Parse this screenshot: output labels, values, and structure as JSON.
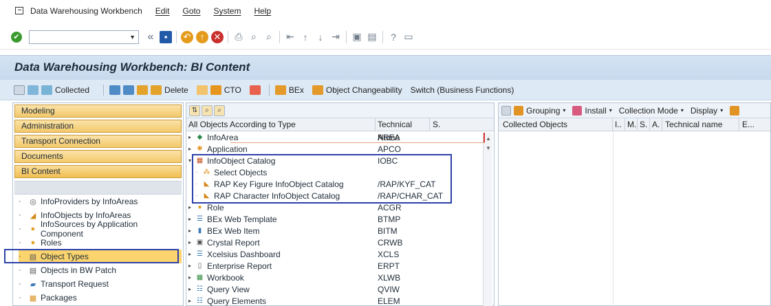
{
  "menu": {
    "items": [
      "Data Warehousing Workbench",
      "Edit",
      "Goto",
      "System",
      "Help"
    ]
  },
  "toolbar": {
    "command_field_value": ""
  },
  "title": "Data Warehousing Workbench: BI Content",
  "app_toolbar": {
    "collected": "Collected",
    "delete": "Delete",
    "cto": "CTO",
    "bex": "BEx",
    "object_changeability": "Object Changeability",
    "switch": "Switch (Business Functions)"
  },
  "nav_buttons": [
    "Modeling",
    "Administration",
    "Transport Connection",
    "Documents",
    "BI Content"
  ],
  "left_tree": [
    {
      "label": "InfoProviders by InfoAreas",
      "icon": "infoprovider-icon"
    },
    {
      "label": "InfoObjects by InfoAreas",
      "icon": "infoobject-icon"
    },
    {
      "label": "InfoSources by Application Component",
      "icon": "infosource-icon"
    },
    {
      "label": "Roles",
      "icon": "role-icon"
    },
    {
      "label": "Object Types",
      "icon": "document-icon"
    },
    {
      "label": "Objects in BW Patch",
      "icon": "document-icon"
    },
    {
      "label": "Transport Request",
      "icon": "transport-icon"
    },
    {
      "label": "Packages",
      "icon": "package-icon"
    }
  ],
  "mid_columns": {
    "c1": "All Objects According to Type",
    "c2": "Technical Name",
    "c3": "S."
  },
  "mid_rows": [
    {
      "name": "InfoArea",
      "tech": "AREA",
      "level": 0,
      "expanded": false
    },
    {
      "name": "Application",
      "tech": "APCO",
      "level": 0,
      "expanded": false
    },
    {
      "name": "InfoObject Catalog",
      "tech": "IOBC",
      "level": 0,
      "expanded": true
    },
    {
      "name": "Select Objects",
      "tech": "",
      "level": 1,
      "expanded": false
    },
    {
      "name": "RAP Key Figure InfoObject Catalog",
      "tech": "/RAP/KYF_CAT",
      "level": 1,
      "expanded": false
    },
    {
      "name": "RAP Character InfoObject Catalog",
      "tech": "/RAP/CHAR_CAT",
      "level": 1,
      "expanded": false
    },
    {
      "name": "Role",
      "tech": "ACGR",
      "level": 0,
      "expanded": false
    },
    {
      "name": "BEx Web Template",
      "tech": "BTMP",
      "level": 0,
      "expanded": false
    },
    {
      "name": "BEx Web Item",
      "tech": "BITM",
      "level": 0,
      "expanded": false
    },
    {
      "name": "Crystal Report",
      "tech": "CRWB",
      "level": 0,
      "expanded": false
    },
    {
      "name": "Xcelsius Dashboard",
      "tech": "XCLS",
      "level": 0,
      "expanded": false
    },
    {
      "name": "Enterprise Report",
      "tech": "ERPT",
      "level": 0,
      "expanded": false
    },
    {
      "name": "Workbook",
      "tech": "XLWB",
      "level": 0,
      "expanded": false
    },
    {
      "name": "Query View",
      "tech": "QVIW",
      "level": 0,
      "expanded": false
    },
    {
      "name": "Query Elements",
      "tech": "ELEM",
      "level": 0,
      "expanded": false
    }
  ],
  "right_toolbar": {
    "grouping": "Grouping",
    "install": "Install",
    "collection_mode": "Collection Mode",
    "display": "Display"
  },
  "right_columns": {
    "collected": "Collected Objects",
    "i": "I..",
    "m": "M.",
    "s": "S.",
    "a": "A.",
    "tech": "Technical name",
    "e": "E..."
  }
}
